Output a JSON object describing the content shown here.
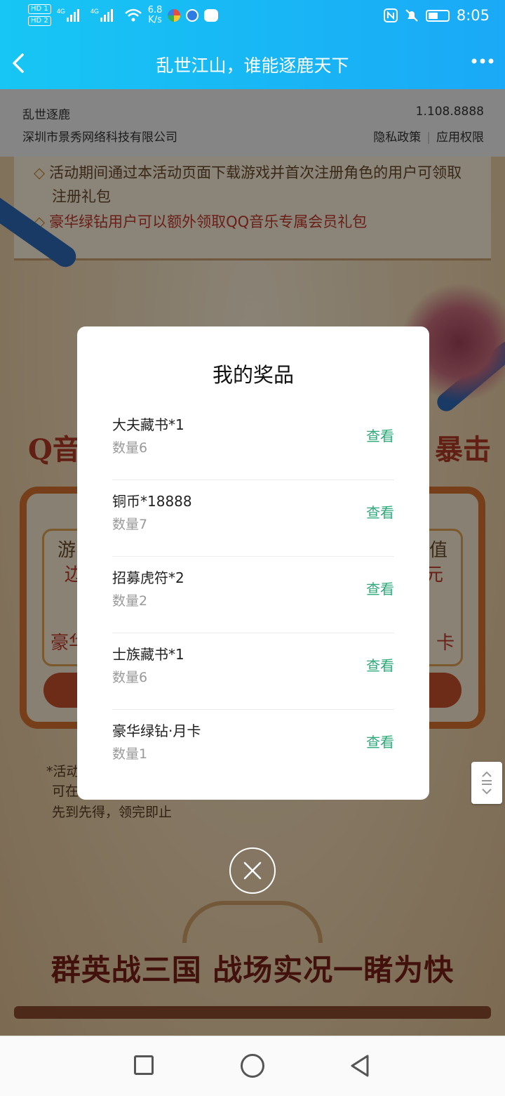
{
  "status_bar": {
    "hd1": "HD 1",
    "hd2": "HD 2",
    "sig1": "4G",
    "sig2": "4G",
    "speed_value": "6.8",
    "speed_unit": "K/s",
    "time": "8:05"
  },
  "header": {
    "title": "乱世江山，谁能逐鹿天下"
  },
  "app_info": {
    "name": "乱世逐鹿",
    "developer": "深圳市景秀网络科技有限公司",
    "version": "1.108.8888",
    "privacy": "隐私政策",
    "separator": "|",
    "permissions": "应用权限"
  },
  "page": {
    "notice_1": "活动期间通过本活动页面下载游戏并首次注册角色的用户可领取",
    "notice_1b": "注册礼包",
    "notice_2": "豪华绿钻用户可以额外领取QQ音乐专属会员礼包",
    "heading_left": "Q音",
    "heading_right": "暴击",
    "frag_you": "游",
    "frag_jin": "边",
    "frag_zhi": "值",
    "frag_yuan": "元",
    "frag_hao": "豪华",
    "frag_ka": "卡",
    "fine_1": "*活动",
    "fine_2": "可在",
    "fine_3": "先到先得，领完即止",
    "slogan": "群英战三国  战场实况一睹为快"
  },
  "modal": {
    "title": "我的奖品",
    "view_label": "查看",
    "prizes": [
      {
        "name": "大夫藏书*1",
        "qty": "数量6"
      },
      {
        "name": "铜币*18888",
        "qty": "数量7"
      },
      {
        "name": "招募虎符*2",
        "qty": "数量2"
      },
      {
        "name": "士族藏书*1",
        "qty": "数量6"
      },
      {
        "name": "豪华绿钻·月卡",
        "qty": "数量1"
      }
    ]
  },
  "colors": {
    "header_gradient_start": "#17c6f4",
    "header_gradient_end": "#1aa9f6",
    "view_link": "#2faa7a"
  },
  "icons": {
    "back": "chevron-left-icon",
    "more": "more-dots-icon",
    "close": "close-circle-icon"
  }
}
